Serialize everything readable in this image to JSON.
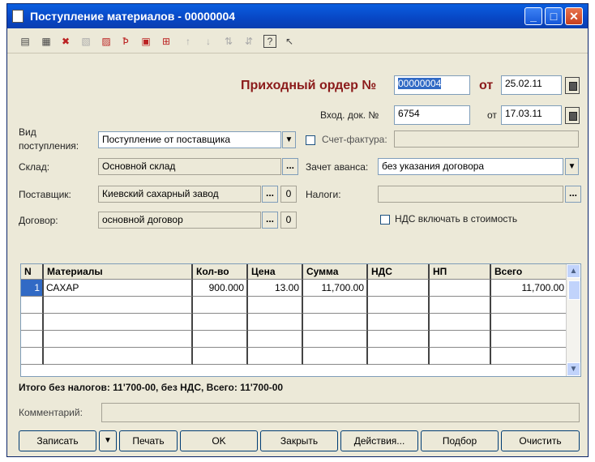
{
  "window": {
    "title": "Поступление материалов - 00000004"
  },
  "header": {
    "order_label": "Приходный ордер №",
    "order_number": "00000004",
    "from_label": "от",
    "order_date": "25.02.11",
    "incoming_doc_label": "Вход. док. №",
    "incoming_doc_number": "6754",
    "incoming_from_label": "от",
    "incoming_doc_date": "17.03.11"
  },
  "form": {
    "receipt_type_label": "Вид\nпоступления:",
    "receipt_type_value": "Поступление от поставщика",
    "warehouse_label": "Склад:",
    "warehouse_value": "Основной склад",
    "supplier_label": "Поставщик:",
    "supplier_value": "Киевский сахарный завод",
    "supplier_balance": "0",
    "contract_label": "Договор:",
    "contract_value": "основной договор",
    "contract_balance": "0",
    "invoice_label": "Счет-фактура:",
    "advance_label": "Зачет аванса:",
    "advance_value": "без указания договора",
    "taxes_label": "Налоги:",
    "taxes_value": "",
    "vat_include_label": "НДС включать в стоимость"
  },
  "table": {
    "columns": [
      "N",
      "Материалы",
      "Кол-во",
      "Цена",
      "Сумма",
      "НДС",
      "НП",
      "Всего"
    ],
    "rows": [
      {
        "n": "1",
        "material": "САХАР",
        "qty": "900.000",
        "price": "13.00",
        "sum": "11,700.00",
        "vat": "",
        "np": "",
        "total": "11,700.00"
      }
    ]
  },
  "totals": {
    "text": "Итого без налогов: 11'700-00, без НДС, Всего: 11'700-00"
  },
  "comment": {
    "label": "Комментарий:",
    "value": ""
  },
  "buttons": {
    "save": "Записать",
    "print": "Печать",
    "ok": "OK",
    "close": "Закрыть",
    "actions": "Действия...",
    "selection": "Подбор",
    "clear": "Очистить"
  },
  "colors": {
    "titlebar": "#0A5FE0",
    "order_label": "#8B1A1A",
    "window_bg": "#ECE9D8"
  }
}
